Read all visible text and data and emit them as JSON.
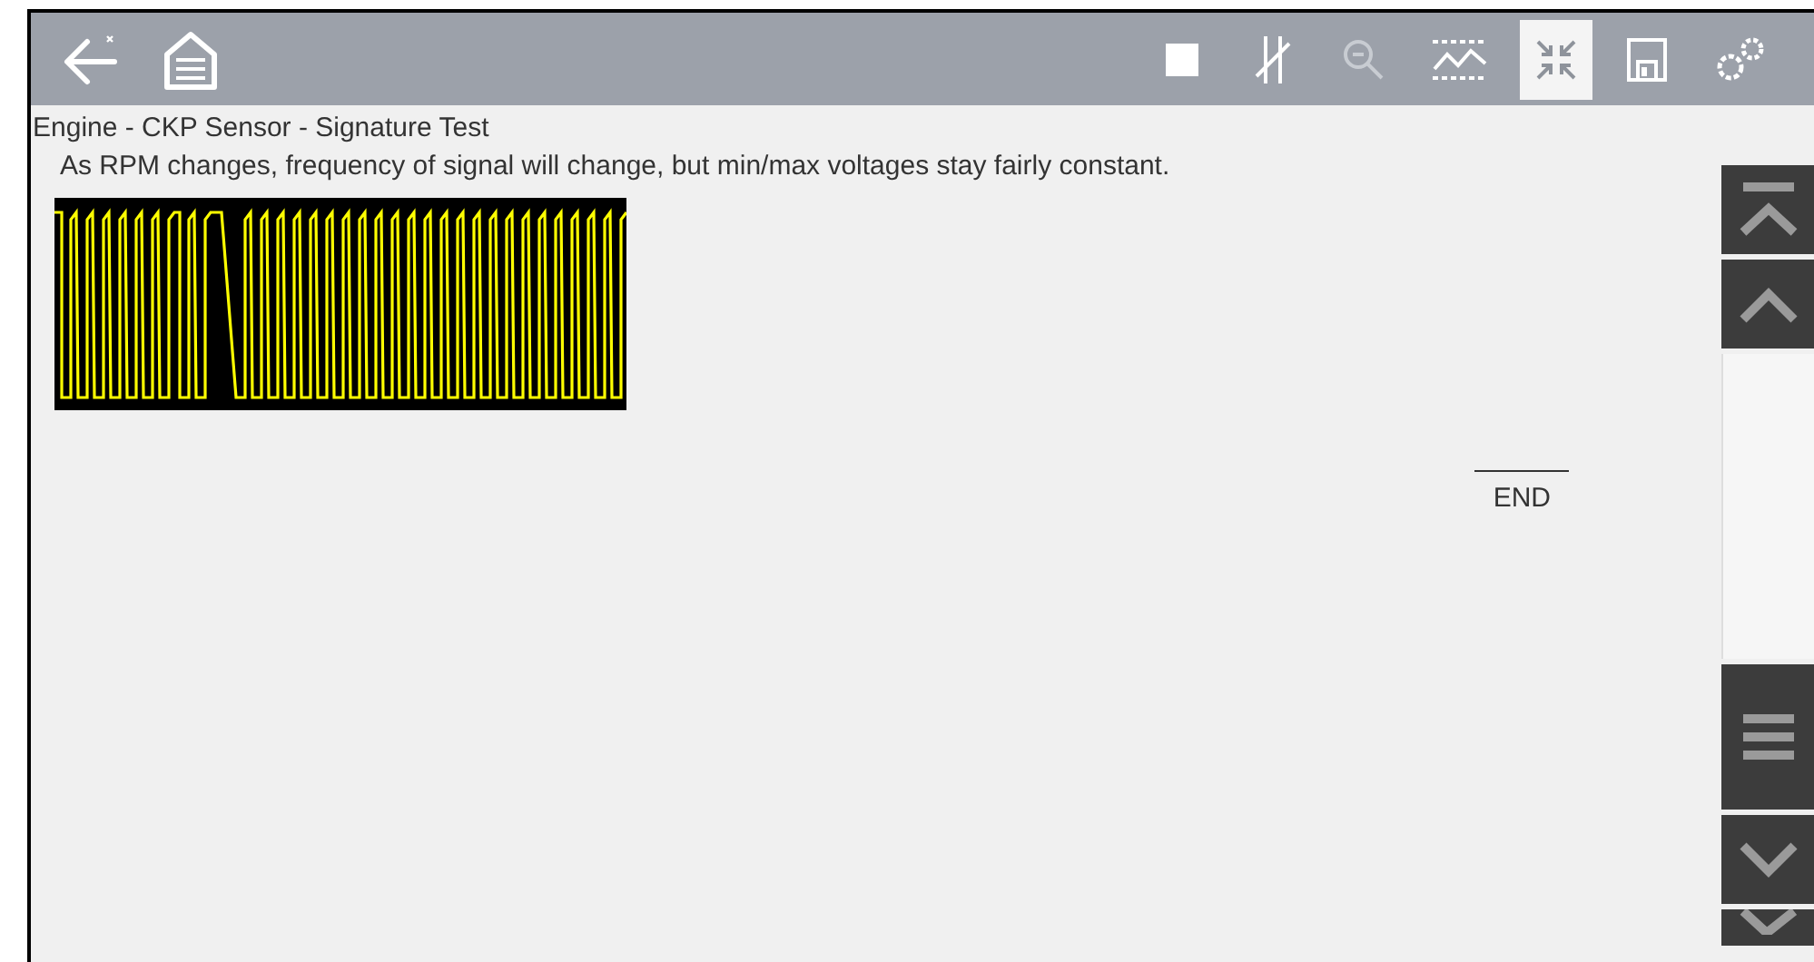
{
  "toolbar": {
    "left": [
      {
        "kind": "back"
      },
      {
        "kind": "home"
      }
    ],
    "right": [
      {
        "kind": "stop",
        "selected": false
      },
      {
        "kind": "cursors",
        "selected": false
      },
      {
        "kind": "zoom",
        "selected": false
      },
      {
        "kind": "filter",
        "selected": false
      },
      {
        "kind": "compress",
        "selected": true
      },
      {
        "kind": "save",
        "selected": false
      },
      {
        "kind": "settings",
        "selected": false
      }
    ]
  },
  "title": "Engine - CKP Sensor - Signature Test",
  "description": "As RPM changes, frequency of signal will change, but min/max voltages stay fairly constant.",
  "end_label": "END"
}
